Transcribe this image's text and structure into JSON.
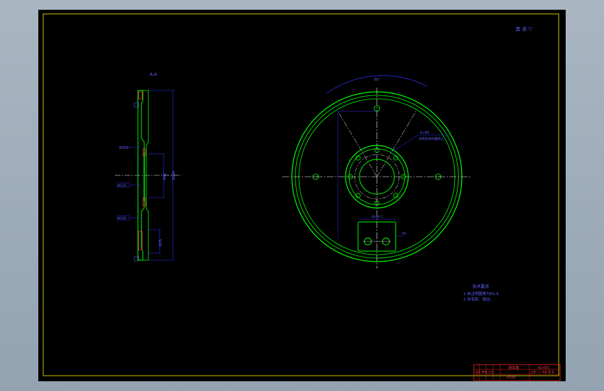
{
  "drawing": {
    "corner_note": "其 余 ▽",
    "side_view_label": "A-A",
    "tech_requirements": {
      "title": "技术要求",
      "lines": [
        "1.未注明圆角为R1.5",
        "2.去毛刺、锐边。"
      ]
    },
    "dims": {
      "arc_top": "60°",
      "hole_callout": "6×Φ9",
      "hole_callout2": "均布在Φ80圆周上",
      "side_left_1": "Φ300",
      "side_left_2": "Φ120",
      "side_left_3": "Φ130",
      "side_right_1": "Φ280",
      "side_right_2": "Φ40",
      "side_right_3": "Φ35",
      "slot_width": "40±0.1",
      "slot_height": "R4"
    },
    "title_block": {
      "drawing_name": "刹车盘",
      "part_no": "XD-001",
      "material": "HT200",
      "scale_label": "比例 1:1 共张 第 张",
      "company": "设计 审核 工艺"
    }
  },
  "colors": {
    "background": "#000000",
    "outline": "#00ff00",
    "dimension": "#0000ff",
    "centerline": "#ffffff",
    "frame": "#ffff00",
    "title_block": "#ff0000",
    "hatch": "#ff0000"
  }
}
